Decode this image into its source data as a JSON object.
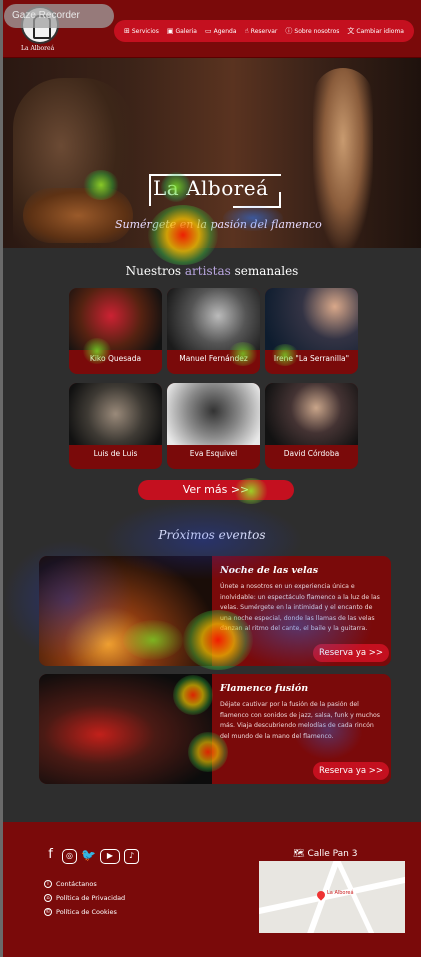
{
  "recorder_badge": "Gaze Recorder",
  "brand": {
    "name": "La Alboreá"
  },
  "nav": [
    {
      "icon": "⊞",
      "label": "Servicios"
    },
    {
      "icon": "▣",
      "label": "Galeria"
    },
    {
      "icon": "▭",
      "label": "Agenda"
    },
    {
      "icon": "☝",
      "label": "Reservar"
    },
    {
      "icon": "ⓘ",
      "label": "Sobre nosotros"
    },
    {
      "icon": "文",
      "label": "Cambiar idioma"
    }
  ],
  "hero": {
    "title": "La Alboreá",
    "subtitle": "Sumérgete en la pasión del flamenco"
  },
  "artists": {
    "title_a": "Nuestros ",
    "title_b": "artistas",
    "title_c": " semanales",
    "items": [
      {
        "name": "Kiko Quesada"
      },
      {
        "name": "Manuel Fernández"
      },
      {
        "name": "Irene \"La Serranilla\""
      },
      {
        "name": "Luis de Luis"
      },
      {
        "name": "Eva Esquivel"
      },
      {
        "name": "David Córdoba"
      }
    ],
    "more_label": "Ver más >>"
  },
  "events": {
    "title": "Próximos eventos",
    "items": [
      {
        "title": "Noche de las velas",
        "text": "Únete a nosotros en un experiencia única e inolvidable: un espectáculo flamenco a la luz de las velas. Sumérgete en la intimidad y el encanto de una noche especial, donde las llamas de las velas danzan al ritmo del cante, el baile y la guitarra.",
        "button": "Reserva ya >>"
      },
      {
        "title": "Flamenco fusión",
        "text": "Déjate cautivar por la fusión de la pasión del flamenco con sonidos de jazz, salsa, funk y muchos más. Viaja descubriendo melodías de cada rincón del mundo de la mano del flamenco.",
        "button": "Reserva ya >>"
      }
    ]
  },
  "footer": {
    "links": [
      {
        "icon": "i",
        "label": "Contáctanos"
      },
      {
        "icon": "⌂",
        "label": "Política de Privacidad"
      },
      {
        "icon": "©",
        "label": "Política de Cookies"
      }
    ],
    "address": "Calle Pan 3",
    "map_label": "La Alboreá"
  },
  "colors": {
    "primary": "#c4101f",
    "dark_red": "#7a0a0a",
    "background": "#2e2e2e"
  }
}
